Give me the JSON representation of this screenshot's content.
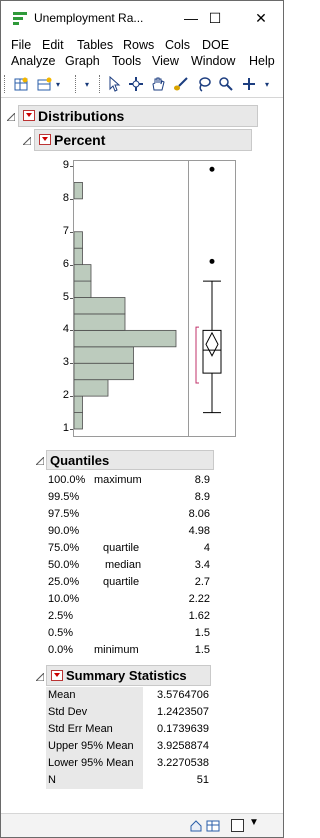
{
  "window": {
    "title": "Unemployment Ra...",
    "minimize": "—",
    "maximize": "☐",
    "close": "✕"
  },
  "menus": {
    "row1": [
      "File",
      "Edit",
      "Tables",
      "Rows",
      "Cols",
      "DOE"
    ],
    "row2": [
      "Analyze",
      "Graph",
      "Tools",
      "View",
      "Window",
      "Help"
    ]
  },
  "report": {
    "distributions_title": "Distributions",
    "variable_title": "Percent",
    "y_ticks": [
      "1",
      "2",
      "3",
      "4",
      "5",
      "6",
      "7",
      "8",
      "9"
    ],
    "histogram_bins": [
      {
        "from": 1,
        "to": 1.5,
        "count": 1
      },
      {
        "from": 1.5,
        "to": 2,
        "count": 1
      },
      {
        "from": 2,
        "to": 2.5,
        "count": 4
      },
      {
        "from": 2.5,
        "to": 3,
        "count": 7
      },
      {
        "from": 3,
        "to": 3.5,
        "count": 7
      },
      {
        "from": 3.5,
        "to": 4,
        "count": 12
      },
      {
        "from": 4,
        "to": 4.5,
        "count": 6
      },
      {
        "from": 4.5,
        "to": 5,
        "count": 6
      },
      {
        "from": 5,
        "to": 5.5,
        "count": 2
      },
      {
        "from": 5.5,
        "to": 6,
        "count": 2
      },
      {
        "from": 6,
        "to": 6.5,
        "count": 1
      },
      {
        "from": 6.5,
        "to": 7,
        "count": 1
      },
      {
        "from": 7,
        "to": 7.5,
        "count": 0
      },
      {
        "from": 7.5,
        "to": 8,
        "count": 0
      },
      {
        "from": 8,
        "to": 8.5,
        "count": 1
      },
      {
        "from": 8.5,
        "to": 9,
        "count": 0
      }
    ],
    "quantiles": {
      "title": "Quantiles",
      "rows": [
        {
          "pct": "100.0%",
          "label": "maximum",
          "value": "8.9"
        },
        {
          "pct": "99.5%",
          "label": "",
          "value": "8.9"
        },
        {
          "pct": "97.5%",
          "label": "",
          "value": "8.06"
        },
        {
          "pct": "90.0%",
          "label": "",
          "value": "4.98"
        },
        {
          "pct": "75.0%",
          "label": "quartile",
          "value": "4"
        },
        {
          "pct": "50.0%",
          "label": "median",
          "value": "3.4"
        },
        {
          "pct": "25.0%",
          "label": "quartile",
          "value": "2.7"
        },
        {
          "pct": "10.0%",
          "label": "",
          "value": "2.22"
        },
        {
          "pct": "2.5%",
          "label": "",
          "value": "1.62"
        },
        {
          "pct": "0.5%",
          "label": "",
          "value": "1.5"
        },
        {
          "pct": "0.0%",
          "label": "minimum",
          "value": "1.5"
        }
      ]
    },
    "summary": {
      "title": "Summary Statistics",
      "rows": [
        {
          "label": "Mean",
          "value": "3.5764706"
        },
        {
          "label": "Std Dev",
          "value": "1.2423507"
        },
        {
          "label": "Std Err Mean",
          "value": "0.1739639"
        },
        {
          "label": "Upper 95% Mean",
          "value": "3.9258874"
        },
        {
          "label": "Lower 95% Mean",
          "value": "3.2270538"
        },
        {
          "label": "N",
          "value": "51"
        }
      ]
    }
  },
  "chart_data": {
    "type": "bar",
    "orientation": "horizontal",
    "y_range": [
      1,
      9
    ],
    "bin_edges": [
      1,
      1.5,
      2,
      2.5,
      3,
      3.5,
      4,
      4.5,
      5,
      5.5,
      6,
      6.5,
      7,
      7.5,
      8,
      8.5,
      9
    ],
    "counts": [
      1,
      1,
      4,
      7,
      7,
      12,
      6,
      6,
      2,
      2,
      1,
      1,
      0,
      0,
      1,
      0
    ],
    "boxplot": {
      "min_whisker": 1.5,
      "q1": 2.7,
      "median": 3.4,
      "q3": 4,
      "max_whisker": 5.5,
      "outliers": [
        6.1,
        8.9
      ],
      "mean": 3.5764706,
      "ci": [
        3.2270538,
        3.9258874
      ]
    }
  },
  "colors": {
    "bar_fill": "#bccbbd",
    "bar_stroke": "#4d4d4d",
    "header_bg": "#e8e8e8",
    "disclosure_red": "#cc0000",
    "ci_bracket": "#c0306a"
  }
}
